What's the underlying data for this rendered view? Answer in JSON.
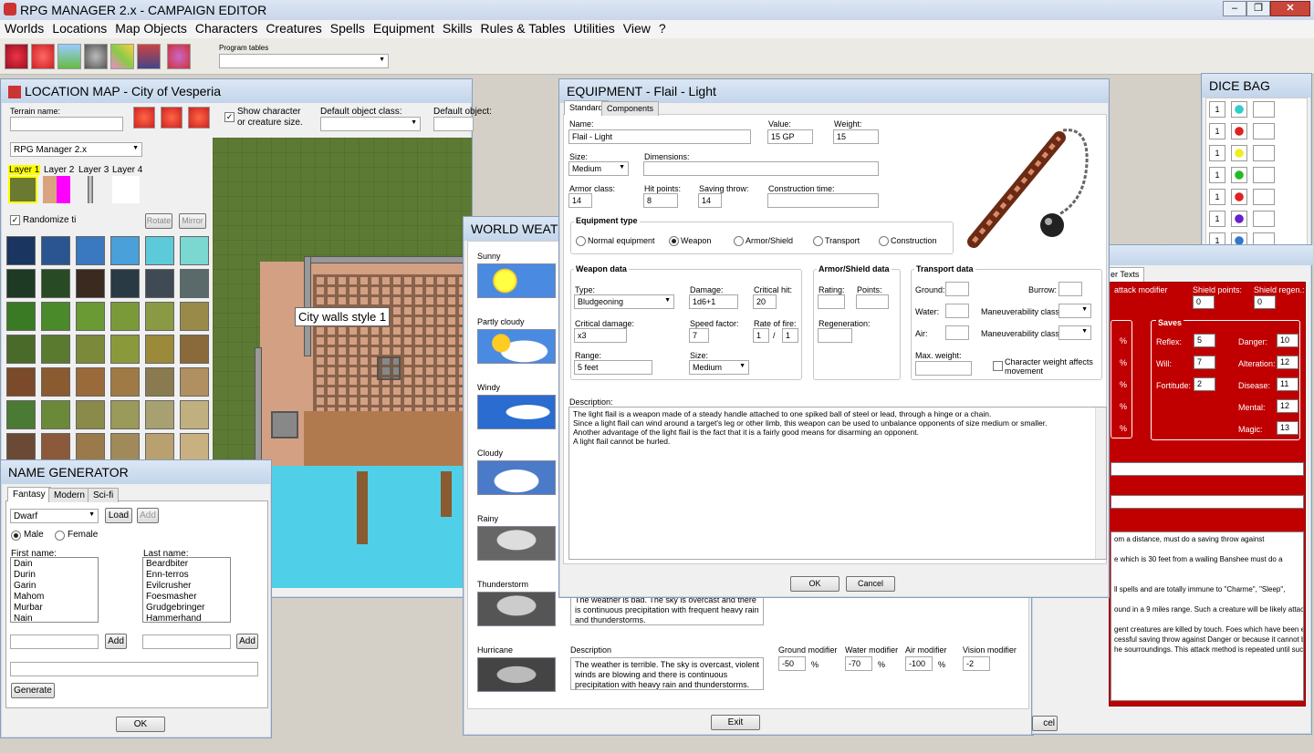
{
  "app_title": "RPG MANAGER 2.x - CAMPAIGN EDITOR",
  "menu": [
    "Worlds",
    "Locations",
    "Map Objects",
    "Characters",
    "Creatures",
    "Spells",
    "Equipment",
    "Skills",
    "Rules & Tables",
    "Utilities",
    "View",
    "?"
  ],
  "program_tables_label": "Program tables",
  "location_map": {
    "title": "LOCATION MAP - City of Vesperia",
    "terrain_name_label": "Terrain name:",
    "show_char_label": "Show character or creature size.",
    "default_class_label": "Default object class:",
    "default_object_label": "Default object:",
    "tileset": "RPG Manager 2.x",
    "layers": [
      "Layer 1",
      "Layer 2",
      "Layer 3",
      "Layer 4"
    ],
    "randomize_label": "Randomize ti",
    "rotate": "Rotate",
    "mirror": "Mirror",
    "tooltip": "City walls style 1"
  },
  "name_gen": {
    "title": "NAME GENERATOR",
    "tabs": [
      "Fantasy",
      "Modern",
      "Sci-fi"
    ],
    "race": "Dwarf",
    "load": "Load",
    "add": "Add",
    "male": "Male",
    "female": "Female",
    "first_label": "First name:",
    "last_label": "Last name:",
    "first_names": [
      "Dain",
      "Durin",
      "Garin",
      "Mahom",
      "Murbar",
      "Nain"
    ],
    "last_names": [
      "Beardbiter",
      "Enn-terros",
      "Evilcrusher",
      "Foesmasher",
      "Grudgebringer",
      "Hammerhand"
    ],
    "generate": "Generate",
    "ok": "OK"
  },
  "weather": {
    "title": "WORLD WEATH",
    "items": [
      "Sunny",
      "Partly cloudy",
      "Windy",
      "Cloudy",
      "Rainy",
      "Thunderstorm",
      "Hurricane"
    ],
    "thunder_desc": "The weather is bad. The sky is overcast and there is continuous precipitation with frequent heavy rain and thunderstorms.",
    "desc_label": "Description",
    "hurricane_desc": "The weather is terrible. The sky is overcast, violent winds are blowing and there is continuous precipitation with heavy rain and thunderstorms.",
    "mods": [
      {
        "label": "Ground modifier",
        "value": "-50"
      },
      {
        "label": "Water modifier",
        "value": "-70"
      },
      {
        "label": "Air modifier",
        "value": "-100"
      },
      {
        "label": "Vision modifier",
        "value": "-2"
      }
    ],
    "pct": "%",
    "exit": "Exit"
  },
  "equipment": {
    "title": "EQUIPMENT - Flail - Light",
    "tabs": [
      "Standard",
      "Components"
    ],
    "name_label": "Name:",
    "name": "Flail - Light",
    "value_label": "Value:",
    "value": "15 GP",
    "weight_label": "Weight:",
    "weight": "15",
    "size_label": "Size:",
    "size": "Medium",
    "dimensions_label": "Dimensions:",
    "ac_label": "Armor class:",
    "ac": "14",
    "hp_label": "Hit points:",
    "hp": "8",
    "save_label": "Saving throw:",
    "save": "14",
    "ctime_label": "Construction time:",
    "etype_label": "Equipment type",
    "etypes": [
      "Normal equipment",
      "Weapon",
      "Armor/Shield",
      "Transport",
      "Construction"
    ],
    "weapon_label": "Weapon data",
    "type_label": "Type:",
    "type": "Bludgeoning",
    "damage_label": "Damage:",
    "damage": "1d6+1",
    "crit_label": "Critical hit:",
    "crit": "20",
    "critdmg_label": "Critical damage:",
    "critdmg": "x3",
    "speed_label": "Speed factor:",
    "speed": "7",
    "rof_label": "Rate of fire:",
    "rof1": "1",
    "rof_sep": "/",
    "rof2": "1",
    "range_label": "Range:",
    "range": "5 feet",
    "wsize_label": "Size:",
    "wsize": "Medium",
    "armor_label": "Armor/Shield data",
    "rating_label": "Rating:",
    "points_label": "Points:",
    "regen_label": "Regeneration:",
    "transport_label": "Transport data",
    "ground_label": "Ground:",
    "burrow_label": "Burrow:",
    "water_label": "Water:",
    "air_label": "Air:",
    "maneuver_label": "Maneuverability class:",
    "maxw_label": "Max. weight:",
    "charw_label": "Character weight affects movement",
    "desc_label": "Description:",
    "desc": [
      "The light flail is a weapon made of a steady handle attached to one spiked ball of steel or lead, through a hinge or a chain.",
      "Since a light flail can wind around a target's leg or other limb, this weapon can be used to unbalance opponents of size medium or smaller.",
      "Another advantage of the light flail is the fact that it is a fairly good means for disarming an opponent.",
      "A light flail cannot be hurled."
    ],
    "ok": "OK",
    "cancel": "Cancel"
  },
  "dice": {
    "title": "DICE BAG",
    "count": "1",
    "colors": [
      "#3cc",
      "#d22",
      "#ee2",
      "#2b2",
      "#d22",
      "#62c",
      "#37c"
    ]
  },
  "creature": {
    "tab": "er Texts",
    "attack_label": "attack modifier",
    "shield_label": "Shield points:",
    "shield": "0",
    "regen_label": "Shield regen.:",
    "regen": "0",
    "pct": "%",
    "saves_label": "Saves",
    "saves": [
      {
        "label": "Reflex:",
        "value": "5"
      },
      {
        "label": "Will:",
        "value": "7"
      },
      {
        "label": "Fortitude:",
        "value": "2"
      }
    ],
    "saves2": [
      {
        "label": "Danger:",
        "value": "10"
      },
      {
        "label": "Alteration:",
        "value": "12"
      },
      {
        "label": "Disease:",
        "value": "11"
      },
      {
        "label": "Mental:",
        "value": "12"
      },
      {
        "label": "Magic:",
        "value": "13"
      }
    ],
    "texts": [
      "om a distance, must do a saving throw against",
      "e which is 30 feet from a wailing Banshee must do a",
      "ll spells and are totally immune to \"Charme\", \"Sleep\",",
      "ound in a 9 miles range. Such a creature will be likely attacked as soon as the",
      "gent creatures are killed by touch. Foes which have been estimated to be",
      "cessful saving throw against Danger or because it cannot be heard, the",
      "he sourroundings. This attack method is repeated until such livings are killed,"
    ],
    "cancel": "cel"
  }
}
